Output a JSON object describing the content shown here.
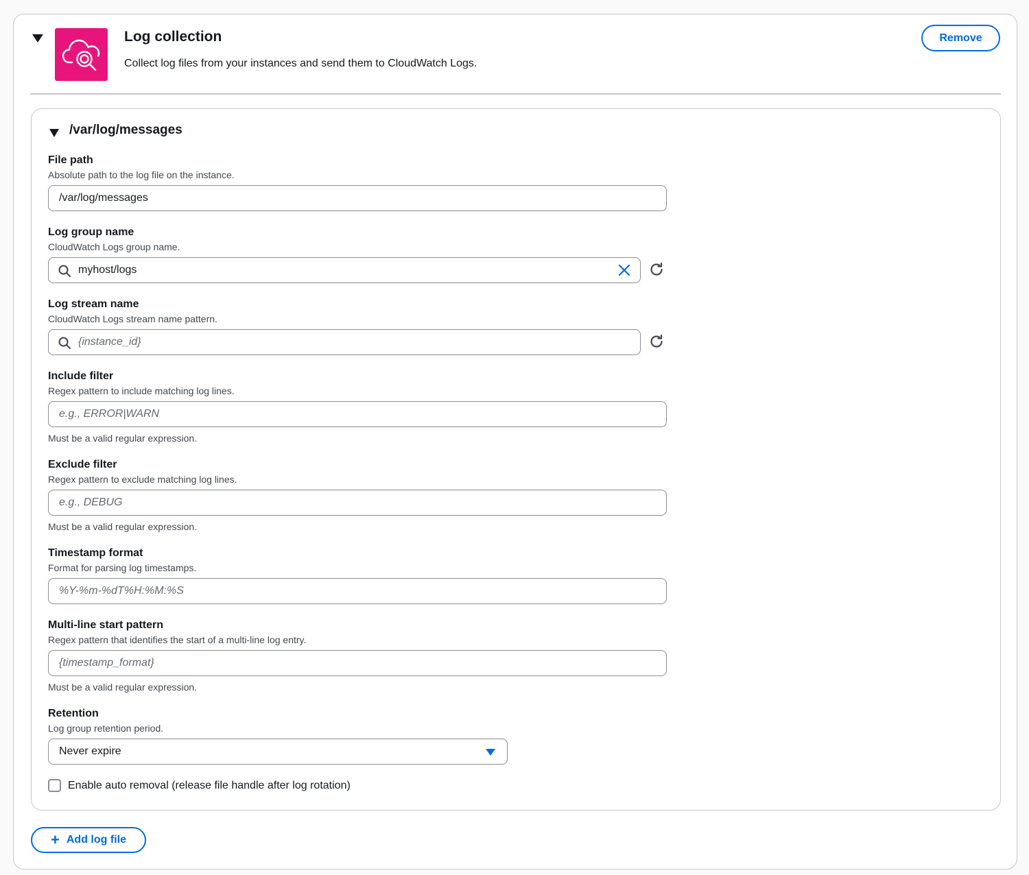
{
  "header": {
    "title": "Log collection",
    "description": "Collect log files from your instances and send them to CloudWatch Logs.",
    "remove_label": "Remove",
    "icon": "cloud-search-icon",
    "icon_bg": "#e7157b"
  },
  "log_file": {
    "title": "/var/log/messages",
    "file_path": {
      "label": "File path",
      "description": "Absolute path to the log file on the instance.",
      "value": "/var/log/messages"
    },
    "log_group": {
      "label": "Log group name",
      "description": "CloudWatch Logs group name.",
      "value": "myhost/logs"
    },
    "log_stream": {
      "label": "Log stream name",
      "description": "CloudWatch Logs stream name pattern.",
      "placeholder": "{instance_id}"
    },
    "include_filter": {
      "label": "Include filter",
      "description": "Regex pattern to include matching log lines.",
      "placeholder": "e.g., ERROR|WARN",
      "help": "Must be a valid regular expression."
    },
    "exclude_filter": {
      "label": "Exclude filter",
      "description": "Regex pattern to exclude matching log lines.",
      "placeholder": "e.g., DEBUG",
      "help": "Must be a valid regular expression."
    },
    "timestamp_format": {
      "label": "Timestamp format",
      "description": "Format for parsing log timestamps.",
      "placeholder": "%Y-%m-%dT%H:%M:%S"
    },
    "multiline": {
      "label": "Multi-line start pattern",
      "description": "Regex pattern that identifies the start of a multi-line log entry.",
      "placeholder": "{timestamp_format}",
      "help": "Must be a valid regular expression."
    },
    "retention": {
      "label": "Retention",
      "description": "Log group retention period.",
      "selected": "Never expire"
    },
    "auto_removal": {
      "label": "Enable auto removal (release file handle after log rotation)",
      "checked": false
    }
  },
  "add_log_file_label": "Add log file",
  "colors": {
    "accent": "#006ce0",
    "border": "#c6c6cd",
    "input_border": "#8c8c94"
  }
}
